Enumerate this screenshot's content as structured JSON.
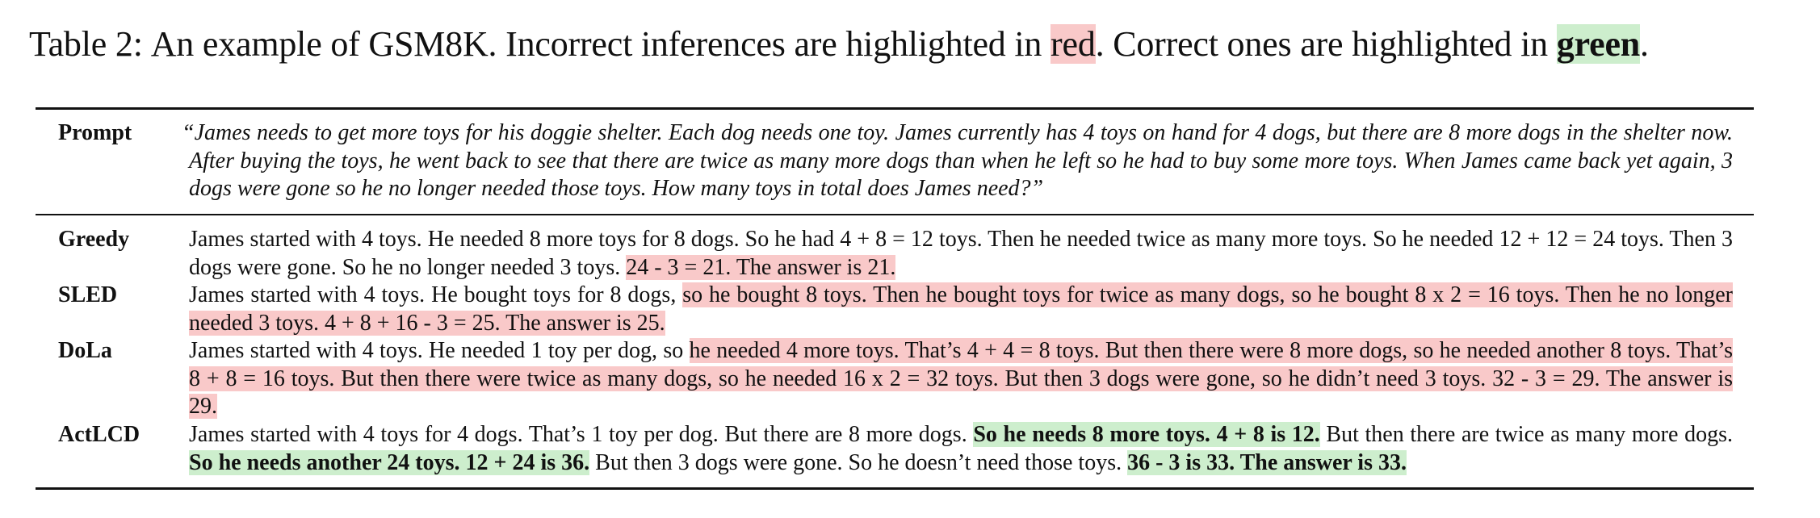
{
  "caption": {
    "label": "Table 2:",
    "text_before": "An example of GSM8K. Incorrect inferences are highlighted in ",
    "red_word": "red",
    "text_middle": ". Correct ones are highlighted in ",
    "green_word": "green",
    "text_after": "."
  },
  "colors": {
    "incorrect_highlight": "#f9c9c9",
    "correct_highlight": "#cdeecd"
  },
  "prompt": {
    "label": "Prompt",
    "text": "“James needs to get more toys for his doggie shelter. Each dog needs one toy. James currently has 4 toys on hand for 4 dogs, but there are 8 more dogs in the shelter now. After buying the toys, he went back to see that there are twice as many more dogs than when he left so he had to buy some more toys. When James came back yet again, 3 dogs were gone so he no longer needed those toys. How many toys in total does James need?”"
  },
  "rows": [
    {
      "label": "Greedy",
      "segments": [
        {
          "text": "James started with 4 toys. He needed 8 more toys for 8 dogs. So he had 4 + 8 = 12 toys. Then he needed twice as many more toys. So he needed 12 + 12 = 24 toys. Then 3 dogs were gone. So he no longer needed 3 toys. ",
          "style": "plain"
        },
        {
          "text": "24 - 3 = 21. The answer is 21.",
          "style": "incorrect"
        }
      ]
    },
    {
      "label": "SLED",
      "segments": [
        {
          "text": "James started with 4 toys. He bought toys for 8 dogs, ",
          "style": "plain"
        },
        {
          "text": "so he bought 8 toys. Then he bought toys for twice as many dogs, so he bought 8 x 2 = 16 toys. Then he no longer needed 3 toys. 4 + 8 + 16 - 3 = 25. The answer is 25.",
          "style": "incorrect"
        }
      ]
    },
    {
      "label": "DoLa",
      "segments": [
        {
          "text": "James started with 4 toys. He needed 1 toy per dog, so ",
          "style": "plain"
        },
        {
          "text": "he needed 4 more toys. That’s 4 + 4 = 8 toys. But then there were 8 more dogs, so he needed another 8 toys. That’s 8 + 8 = 16 toys. But then there were twice as many dogs, so he needed 16 x 2 = 32 toys. But then 3 dogs were gone, so he didn’t need 3 toys. 32 - 3 = 29. The answer is 29.",
          "style": "incorrect"
        }
      ]
    },
    {
      "label": "ActLCD",
      "segments": [
        {
          "text": "James started with 4 toys for 4 dogs. That’s 1 toy per dog. But there are 8 more dogs. ",
          "style": "plain"
        },
        {
          "text": "So he needs 8 more toys. 4 + 8 is 12.",
          "style": "correct"
        },
        {
          "text": " But then there are twice as many more dogs. ",
          "style": "plain"
        },
        {
          "text": "So he needs another 24 toys. 12 + 24 is 36.",
          "style": "correct"
        },
        {
          "text": " But then 3 dogs were gone. So he doesn’t need those toys. ",
          "style": "plain"
        },
        {
          "text": "36 - 3 is 33. The answer is 33.",
          "style": "correct"
        }
      ]
    }
  ]
}
